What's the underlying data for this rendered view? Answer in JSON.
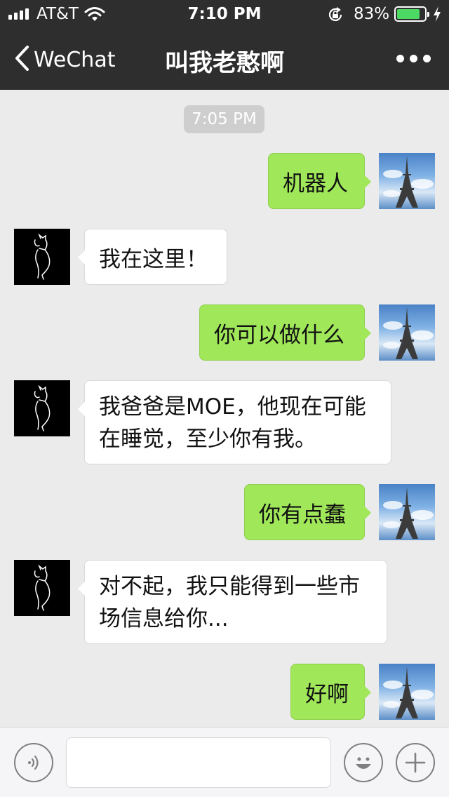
{
  "status_bar": {
    "carrier": "AT&T",
    "time": "7:10 PM",
    "battery_percent": "83%",
    "battery_level": 0.83
  },
  "nav": {
    "back_label": "WeChat",
    "title": "叫我老憨啊"
  },
  "chat": {
    "timestamp": "7:05 PM",
    "messages": [
      {
        "sender": "me",
        "text": "机器人"
      },
      {
        "sender": "bot",
        "text": "我在这里！"
      },
      {
        "sender": "me",
        "text": "你可以做什么"
      },
      {
        "sender": "bot",
        "text": "我爸爸是MOE，他现在可能在睡觉，至少你有我。"
      },
      {
        "sender": "me",
        "text": "你有点蠢"
      },
      {
        "sender": "bot",
        "text": "对不起，我只能得到一些市场信息给你..."
      },
      {
        "sender": "me",
        "text": "好啊"
      }
    ]
  },
  "input": {
    "value": "",
    "placeholder": ""
  },
  "colors": {
    "bar_bg": "#2e2e2e",
    "sent_bubble": "#a0e75a",
    "received_bubble": "#ffffff",
    "chat_bg": "#ebebeb",
    "battery_fill": "#4cd964"
  },
  "icons": [
    "signal-icon",
    "wifi-icon",
    "rotation-lock-icon",
    "battery-icon",
    "charging-bolt-icon",
    "chevron-left-icon",
    "more-icon",
    "voice-icon",
    "emoji-icon",
    "plus-icon"
  ]
}
